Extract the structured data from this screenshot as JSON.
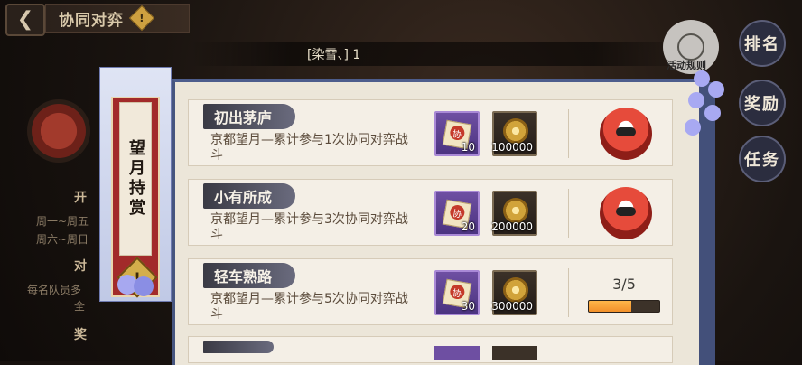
{
  "header": {
    "back_glyph": "❮",
    "title": "协同对弈",
    "warning_glyph": "!"
  },
  "top_name": "[染雪、] 1",
  "left_bg": {
    "l1": "开",
    "l2": "周一~周五",
    "l3": "周六~周日",
    "l4": "对",
    "l5": "每名队员多",
    "l6": "全",
    "l7": "奖"
  },
  "side_banner": {
    "title": "望月持赏",
    "warning_glyph": "!"
  },
  "right_nav": {
    "rank": "排名",
    "reward": "奖励",
    "task": "任务",
    "activity_label": "活动规则"
  },
  "rows": [
    {
      "name": "初出茅庐",
      "desc": "京都望月—累计参与1次协同对弈战斗",
      "reward_a_qty": "10",
      "reward_b_qty": "100000",
      "state": "claim"
    },
    {
      "name": "小有所成",
      "desc": "京都望月—累计参与3次协同对弈战斗",
      "reward_a_qty": "20",
      "reward_b_qty": "200000",
      "state": "claim"
    },
    {
      "name": "轻车熟路",
      "desc": "京都望月—累计参与5次协同对弈战斗",
      "reward_a_qty": "30",
      "reward_b_qty": "300000",
      "state": "progress",
      "progress_text": "3/5",
      "progress_value": 0.6
    }
  ],
  "colors": {
    "accent": "#4d5d8c",
    "paper": "#ece6d9",
    "banner_red": "#a22a2a",
    "progress": "#f2902a"
  }
}
